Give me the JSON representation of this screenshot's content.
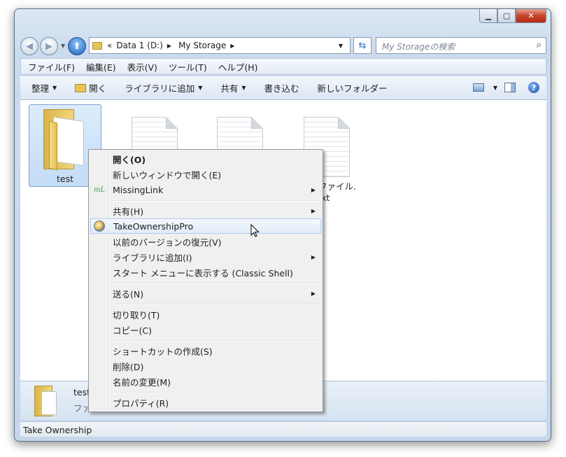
{
  "window": {
    "caption_min": "▁",
    "caption_max": "▢",
    "caption_close": "✕"
  },
  "nav": {
    "back_glyph": "◀",
    "forward_glyph": "▶",
    "up_glyph": "⬆",
    "address": {
      "overflow": "«",
      "crumbs": [
        "Data 1 (D:)",
        "My Storage"
      ],
      "chevron": "▶",
      "dropdown": "▼"
    },
    "refresh_glyph": "⇆",
    "search_placeholder": "My Storageの検索",
    "search_icon": "⌕"
  },
  "menubar": [
    "ファイル(F)",
    "編集(E)",
    "表示(V)",
    "ツール(T)",
    "ヘルプ(H)"
  ],
  "toolbar": {
    "organize": "整理",
    "open": "開く",
    "add_to_library": "ライブラリに追加",
    "share": "共有",
    "burn": "書き込む",
    "new_folder": "新しいフォルダー",
    "arrow": "▼",
    "help": "?"
  },
  "files": [
    {
      "name": "test",
      "kind": "folder",
      "selected": true
    },
    {
      "name": "",
      "kind": "document"
    },
    {
      "name": "",
      "kind": "document"
    },
    {
      "name_line1": "ファイル.",
      "name_line2": "xt",
      "kind": "document"
    }
  ],
  "details": {
    "name": "test",
    "type": "ファ"
  },
  "status": "Take Ownership",
  "context_menu": {
    "items": [
      {
        "label": "開く(O)",
        "bold": true
      },
      {
        "label": "新しいウィンドウで開く(E)"
      },
      {
        "label": "MissingLink",
        "icon": "mL",
        "submenu": true
      },
      {
        "label": "共有(H)",
        "submenu": true
      },
      {
        "label": "TakeOwnershipPro",
        "icon": "take-ownership-icon",
        "highlighted": true
      },
      {
        "label": "以前のバージョンの復元(V)"
      },
      {
        "label": "ライブラリに追加(I)",
        "submenu": true
      },
      {
        "label": "スタート メニューに表示する (Classic Shell)"
      },
      {
        "label": "送る(N)",
        "submenu": true
      },
      {
        "label": "切り取り(T)"
      },
      {
        "label": "コピー(C)"
      },
      {
        "label": "ショートカットの作成(S)"
      },
      {
        "label": "削除(D)"
      },
      {
        "label": "名前の変更(M)"
      },
      {
        "label": "プロパティ(R)"
      }
    ],
    "submenu_glyph": "▶"
  }
}
